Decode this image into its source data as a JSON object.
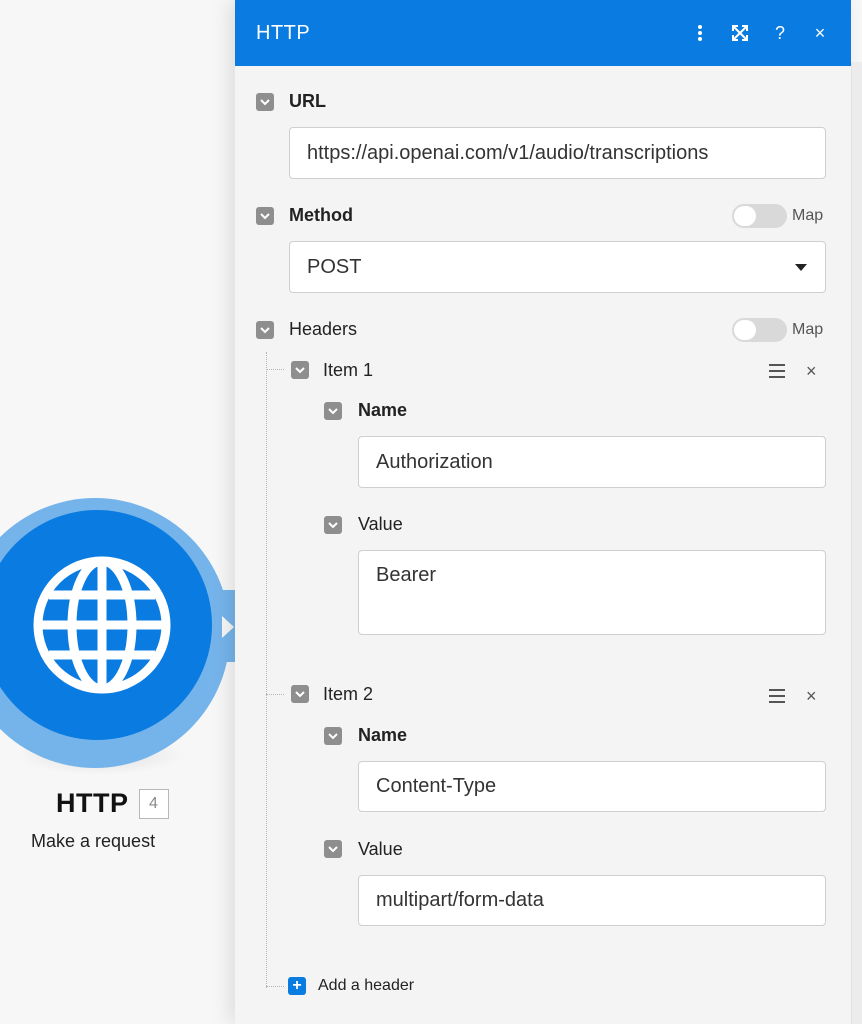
{
  "node": {
    "name": "HTTP",
    "badge": "4",
    "subtitle": "Make a request",
    "icon": "globe-icon"
  },
  "panel": {
    "title": "HTTP",
    "header_icons": [
      "more-vertical-icon",
      "expand-icon",
      "help-icon",
      "close-icon"
    ],
    "help_glyph": "?",
    "close_glyph": "×"
  },
  "url": {
    "label": "URL",
    "value": "https://api.openai.com/v1/audio/transcriptions"
  },
  "method": {
    "label": "Method",
    "value": "POST",
    "map_label": "Map"
  },
  "headers": {
    "label": "Headers",
    "map_label": "Map",
    "items": [
      {
        "title": "Item 1",
        "name_label": "Name",
        "name_value": "Authorization",
        "value_label": "Value",
        "value_value": "Bearer"
      },
      {
        "title": "Item 2",
        "name_label": "Name",
        "name_value": "Content-Type",
        "value_label": "Value",
        "value_value": "multipart/form-data"
      }
    ],
    "remove_glyph": "×",
    "add_glyph": "+",
    "add_label": "Add a header"
  },
  "colors": {
    "accent": "#0a7be0",
    "node_ring": "#75b4eb",
    "checkbox": "#8e8e8e"
  }
}
